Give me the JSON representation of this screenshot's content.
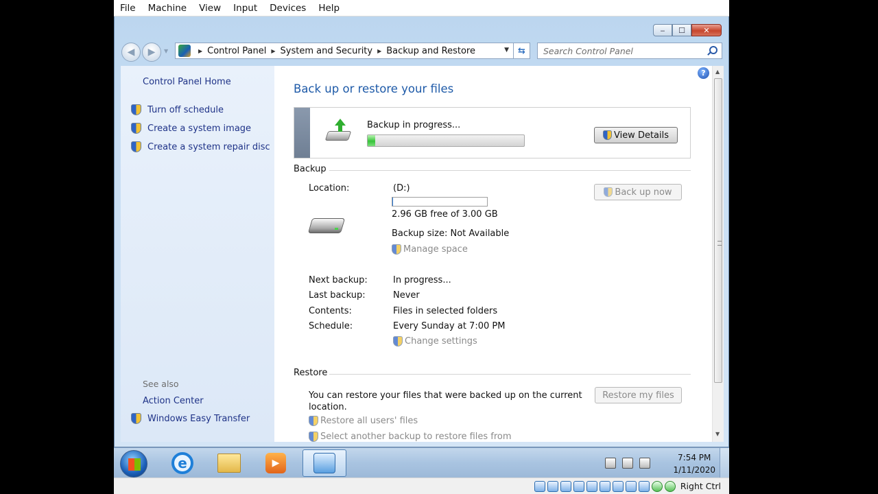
{
  "host_menu": [
    "File",
    "Machine",
    "View",
    "Input",
    "Devices",
    "Help"
  ],
  "window": {
    "caption_min": "▭",
    "caption_max": "☐",
    "caption_close": "✕"
  },
  "address_bar": {
    "crumbs": [
      "Control Panel",
      "System and Security",
      "Backup and Restore"
    ],
    "search_placeholder": "Search Control Panel"
  },
  "left_pane": {
    "home": "Control Panel Home",
    "tasks": [
      "Turn off schedule",
      "Create a system image",
      "Create a system repair disc"
    ],
    "see_also_label": "See also",
    "see_also": [
      "Action Center",
      "Windows Easy Transfer"
    ]
  },
  "main": {
    "title": "Back up or restore your files",
    "progress_label": "Backup in progress...",
    "progress_fraction": 0.05,
    "view_details": "View Details",
    "backup_section": "Backup",
    "location_label": "Location:",
    "location_value": "(D:)",
    "capacity_used_fraction": 0.01,
    "free_space": "2.96 GB free of 3.00 GB",
    "backup_size": "Backup size: Not Available",
    "manage_space": "Manage space",
    "back_up_now": "Back up now",
    "details": [
      {
        "label": "Next backup:",
        "value": "In progress..."
      },
      {
        "label": "Last backup:",
        "value": "Never"
      },
      {
        "label": "Contents:",
        "value": "Files in selected folders"
      },
      {
        "label": "Schedule:",
        "value": "Every Sunday at 7:00 PM"
      }
    ],
    "change_settings": "Change settings",
    "restore_section": "Restore",
    "restore_text_1": "You can restore your files that were backed up on the current",
    "restore_text_2": "location.",
    "restore_my_files": "Restore my files",
    "restore_all_users": "Restore all users' files",
    "select_another": "Select another backup to restore files from"
  },
  "taskbar": {
    "clock_time": "7:54 PM",
    "clock_date": "1/11/2020"
  },
  "host_status": {
    "right_ctrl": "Right Ctrl"
  }
}
